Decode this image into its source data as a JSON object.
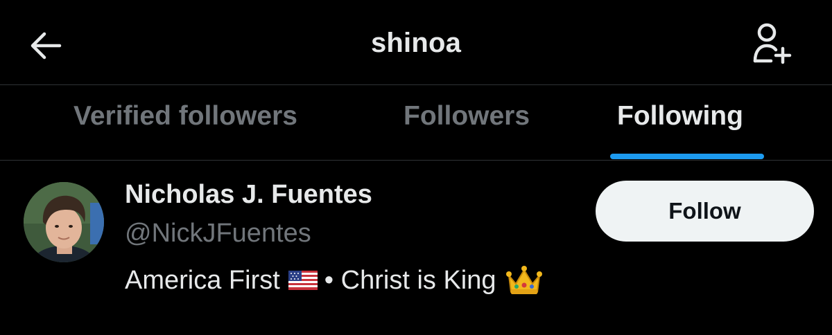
{
  "header": {
    "title": "shinoa",
    "back_icon": "arrow-left-icon",
    "add_user_icon": "add-user-icon"
  },
  "tabs": [
    {
      "label": "Verified followers",
      "active": false
    },
    {
      "label": "Followers",
      "active": false
    },
    {
      "label": "Following",
      "active": true
    }
  ],
  "user": {
    "name": "Nicholas J. Fuentes",
    "handle": "@NickJFuentes",
    "bio_part1": "America First",
    "bio_part2": "• Christ is King",
    "bio_emojis": [
      "us-flag-icon",
      "crown-icon"
    ],
    "follow_label": "Follow"
  },
  "colors": {
    "background": "#000000",
    "text_primary": "#e7e9ea",
    "text_secondary": "#71767b",
    "accent": "#1d9bf0",
    "button_bg": "#eff3f4",
    "divider": "#2f3336"
  }
}
